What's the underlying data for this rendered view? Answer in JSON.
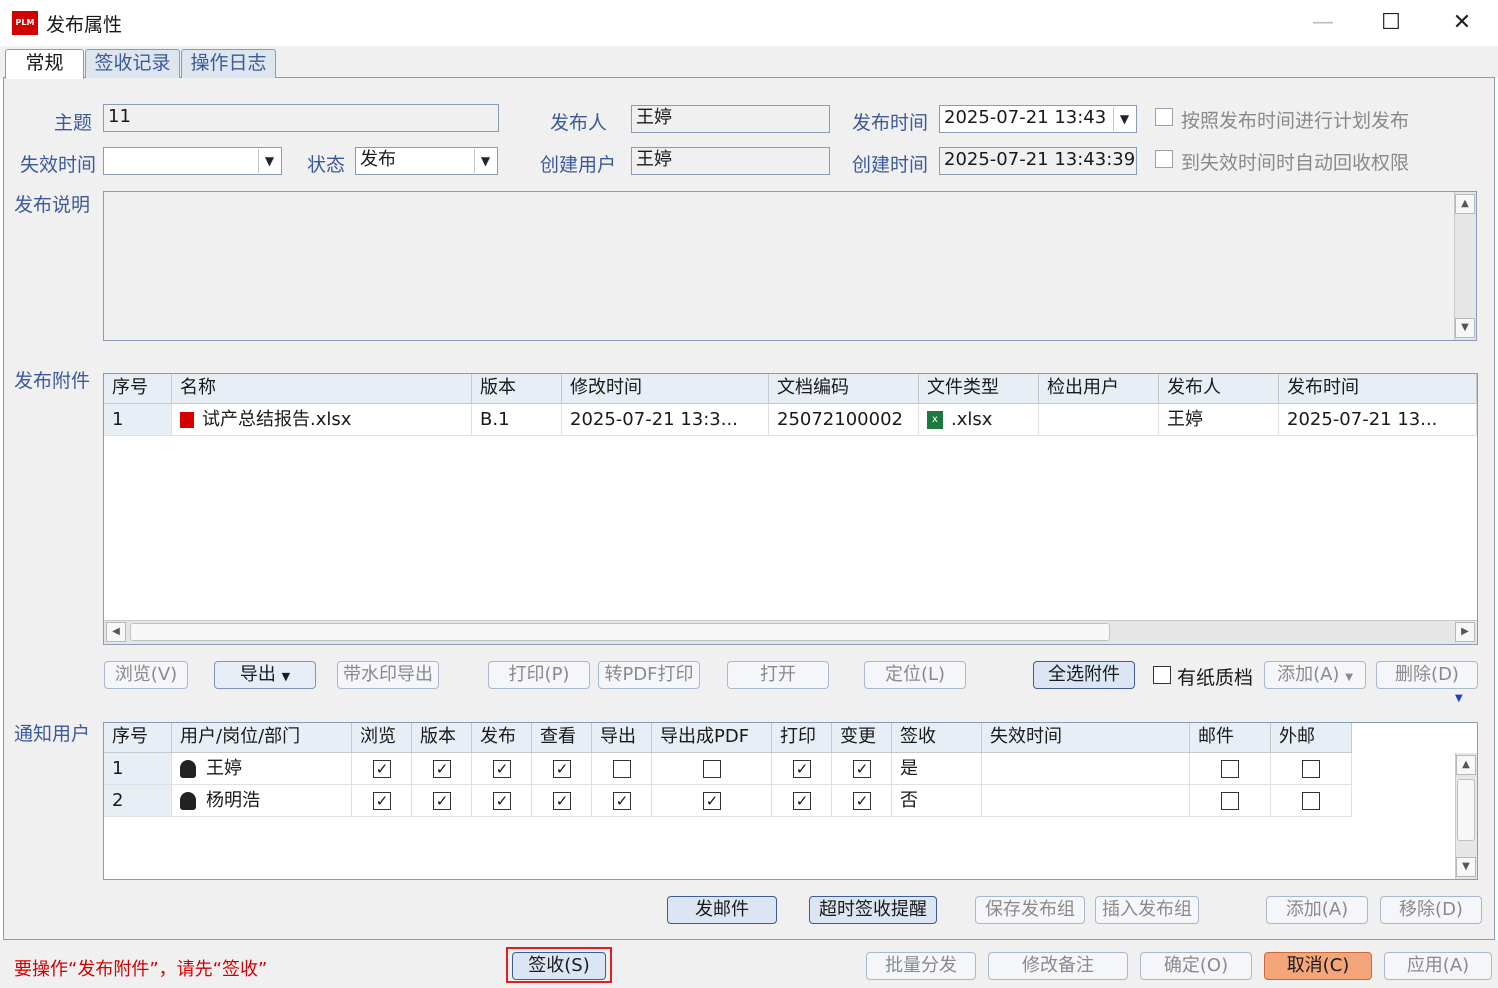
{
  "window": {
    "app_icon_text": "PLM",
    "title": "发布属性",
    "min_symbol": "—",
    "max_symbol": "☐",
    "close_symbol": "✕"
  },
  "tabs": [
    {
      "label": "常规",
      "active": true
    },
    {
      "label": "签收记录",
      "active": false
    },
    {
      "label": "操作日志",
      "active": false
    }
  ],
  "form": {
    "subject_label": "主题",
    "subject_value": "11",
    "publisher_label": "发布人",
    "publisher_value": "王婷",
    "publish_time_label": "发布时间",
    "publish_time_value": "2025-07-21 13:43",
    "plan_publish_label": "按照发布时间进行计划发布",
    "plan_publish_checked": false,
    "expire_time_label": "失效时间",
    "expire_time_value": "",
    "status_label": "状态",
    "status_value": "发布",
    "creator_label": "创建用户",
    "creator_value": "王婷",
    "create_time_label": "创建时间",
    "create_time_value": "2025-07-21 13:43:39",
    "auto_revoke_label": "到失效时间时自动回收权限",
    "auto_revoke_checked": false,
    "desc_label": "发布说明",
    "desc_value": ""
  },
  "attachments": {
    "section_label": "发布附件",
    "columns": [
      "序号",
      "名称",
      "版本",
      "修改时间",
      "文档编码",
      "文件类型",
      "检出用户",
      "发布人",
      "发布时间"
    ],
    "rows": [
      {
        "index": "1",
        "name": "试产总结报告.xlsx",
        "version": "B.1",
        "modified": "2025-07-21 13:3...",
        "code": "25072100002",
        "type": ".xlsx",
        "checkout_user": "",
        "publisher": "王婷",
        "publish_time": "2025-07-21 13..."
      }
    ],
    "buttons": {
      "browse": "浏览(V)",
      "export": "导出",
      "export_watermark": "带水印导出",
      "print": "打印(P)",
      "pdf_print": "转PDF打印",
      "open": "打开",
      "locate": "定位(L)",
      "select_all": "全选附件",
      "paper_doc": "有纸质档",
      "add": "添加(A)",
      "delete": "删除(D)"
    }
  },
  "notify": {
    "section_label": "通知用户",
    "columns": [
      "序号",
      "用户/岗位/部门",
      "浏览",
      "版本",
      "发布",
      "查看",
      "导出",
      "导出成PDF",
      "打印",
      "变更",
      "签收",
      "失效时间",
      "邮件",
      "外邮"
    ],
    "rows": [
      {
        "index": "1",
        "user": "王婷",
        "browse": true,
        "version": true,
        "publish": true,
        "view": true,
        "export": false,
        "export_pdf": false,
        "print": true,
        "change": true,
        "signed": "是",
        "expire": "",
        "mail": false,
        "ext_mail": false
      },
      {
        "index": "2",
        "user": "杨明浩",
        "browse": true,
        "version": true,
        "publish": true,
        "view": true,
        "export": true,
        "export_pdf": true,
        "print": true,
        "change": true,
        "signed": "否",
        "expire": "",
        "mail": false,
        "ext_mail": false
      }
    ],
    "buttons": {
      "send_mail": "发邮件",
      "overdue_remind": "超时签收提醒",
      "save_group": "保存发布组",
      "insert_group": "插入发布组",
      "add": "添加(A)",
      "remove": "移除(D)"
    }
  },
  "footer": {
    "warning": "要操作“发布附件”，请先“签收”",
    "sign": "签收(S)",
    "batch": "批量分发",
    "edit_note": "修改备注",
    "ok": "确定(O)",
    "cancel": "取消(C)",
    "apply": "应用(A)"
  },
  "colors": {
    "label_blue": "#3c5a9a",
    "warning_red": "#d40000",
    "cancel_orange": "#f4a57a",
    "header_bg": "#e8eef6"
  }
}
